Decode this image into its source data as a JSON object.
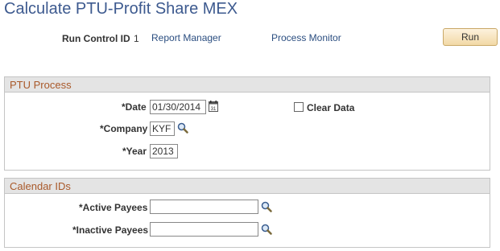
{
  "page": {
    "title": "Calculate PTU-Profit Share MEX"
  },
  "toolbar": {
    "run_control_label": "Run Control ID",
    "run_control_value": "1",
    "report_manager": "Report Manager",
    "process_monitor": "Process Monitor",
    "run": "Run"
  },
  "ptu": {
    "title": "PTU Process",
    "date_label": "*Date",
    "date_value": "01/30/2014",
    "clear_data_label": "Clear Data",
    "clear_data_checked": false,
    "company_label": "*Company",
    "company_value": "KYF",
    "year_label": "*Year",
    "year_value": "2013"
  },
  "calendar": {
    "title": "Calendar IDs",
    "active_label": "*Active Payees",
    "active_value": "",
    "inactive_label": "*Inactive Payees",
    "inactive_value": ""
  },
  "icons": {
    "calendar": "calendar-icon",
    "lookup": "magnifier-lookup-icon"
  }
}
